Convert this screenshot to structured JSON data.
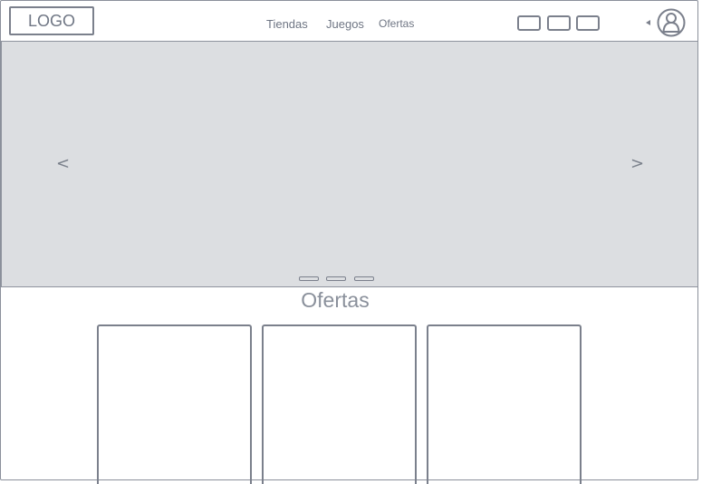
{
  "header": {
    "logo": "LOGO",
    "nav": [
      "Tiendas",
      "Juegos",
      "Ofertas"
    ]
  },
  "carousel": {
    "prev": "<",
    "next": ">",
    "slide_count": 3
  },
  "offers": {
    "title": "Ofertas",
    "card_count": 3
  },
  "colors": {
    "stroke": "#7b808c",
    "carousel_bg": "#dcdee1",
    "text": "#6f7684"
  }
}
